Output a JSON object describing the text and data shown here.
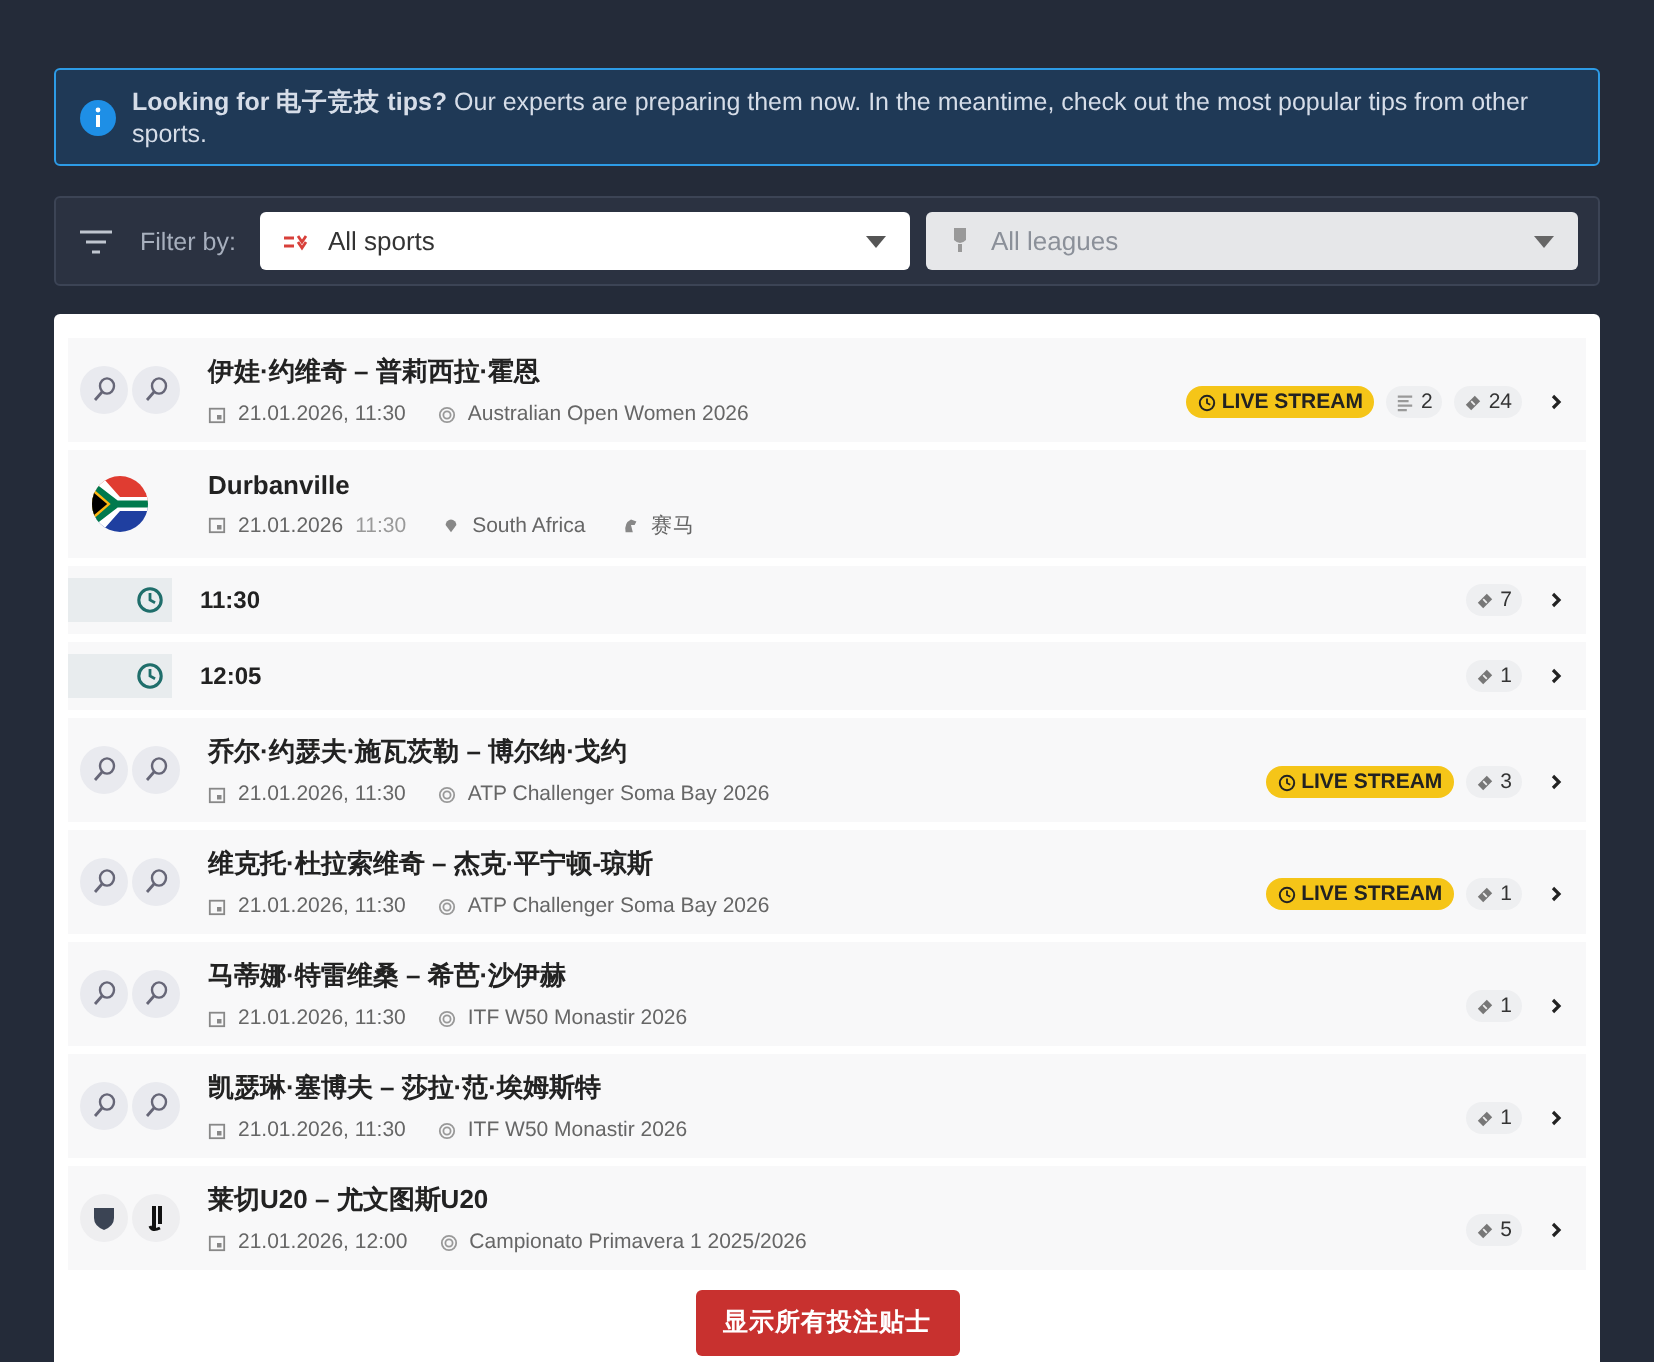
{
  "notice": {
    "text": "**Looking for 电子竞技 tips?** Our experts are preparing them now. In the meantime, check out the most popular tips from other sports."
  },
  "filter": {
    "label": "Filter by:",
    "selects": [
      {
        "value": "All sports",
        "disabled": false
      },
      {
        "value": "All leagues",
        "disabled": true
      }
    ]
  },
  "events": [
    {
      "kind": "tennis",
      "title": "伊娃·约维奇 – 普莉西拉·霍恩",
      "datetime": "21.01.2026, 11:30",
      "league": "Australian Open Women 2026",
      "live": "LIVE STREAM",
      "stats": "2",
      "tips": "24"
    },
    {
      "kind": "venue",
      "title": "Durbanville",
      "date": "21.01.2026",
      "time": "11:30",
      "country": "South Africa",
      "sport": "赛马"
    },
    {
      "kind": "race",
      "time": "11:30",
      "tips": "7"
    },
    {
      "kind": "race",
      "time": "12:05",
      "tips": "1"
    },
    {
      "kind": "tennis",
      "title": "乔尔·约瑟夫·施瓦茨勒 – 博尔纳·戈约",
      "datetime": "21.01.2026, 11:30",
      "league": "ATP Challenger Soma Bay 2026",
      "live": "LIVE STREAM",
      "tips": "3"
    },
    {
      "kind": "tennis",
      "title": "维克托·杜拉索维奇 – 杰克·平宁顿-琼斯",
      "datetime": "21.01.2026, 11:30",
      "league": "ATP Challenger Soma Bay 2026",
      "live": "LIVE STREAM",
      "tips": "1"
    },
    {
      "kind": "tennis",
      "title": "马蒂娜·特雷维桑 – 希芭·沙伊赫",
      "datetime": "21.01.2026, 11:30",
      "league": "ITF W50 Monastir 2026",
      "tips": "1"
    },
    {
      "kind": "tennis",
      "title": "凯瑟琳·塞博夫 – 莎拉·范·埃姆斯特",
      "datetime": "21.01.2026, 11:30",
      "league": "ITF W50 Monastir 2026",
      "tips": "1"
    },
    {
      "kind": "football",
      "title": "莱切U20 – 尤文图斯U20",
      "datetime": "21.01.2026, 12:00",
      "league": "Campionato Primavera 1 2025/2026",
      "tips": "5"
    }
  ],
  "show_all_button": "显示所有投注贴士"
}
